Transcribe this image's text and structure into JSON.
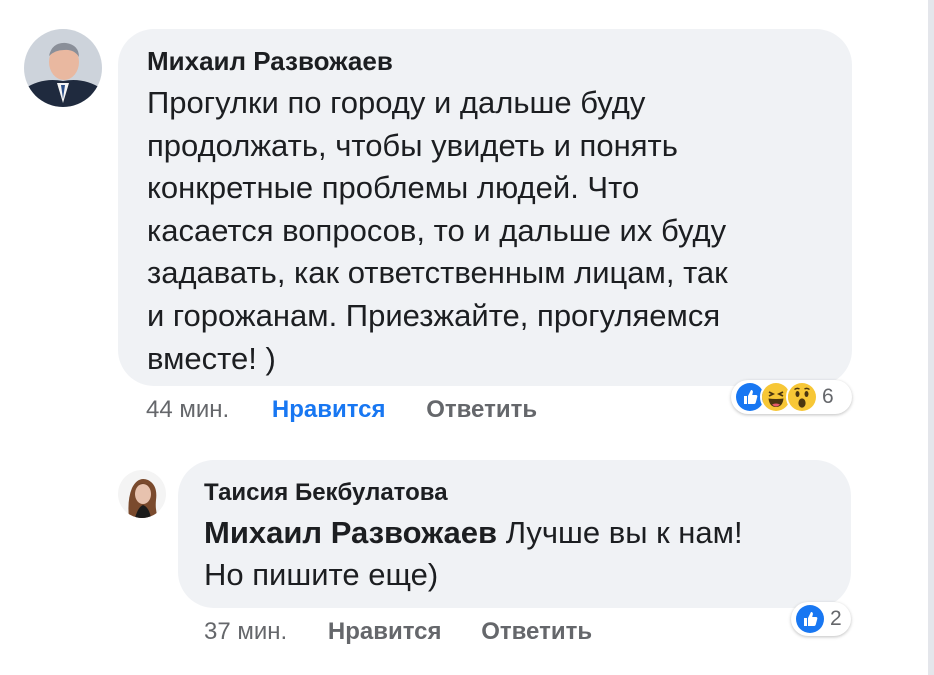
{
  "comments": [
    {
      "author": "Михаил Развожаев",
      "text": "Прогулки по городу и дальше буду\nпродолжать, чтобы увидеть и понять\nконкретные проблемы людей. Что\nкасается вопросов, то и дальше их буду\nзадавать, как ответственным лицам, так\nи горожанам. Приезжайте, прогуляемся\nвместе! )",
      "time": "44 мин.",
      "like_label": "Нравится",
      "reply_label": "Ответить",
      "reaction_icons": [
        "like-icon",
        "haha-icon",
        "wow-icon"
      ],
      "reaction_count": "6"
    },
    {
      "author": "Таисия Бекбулатова",
      "mention": "Михаил Развожаев",
      "text": " Лучше вы к нам!\nНо пишите еще)",
      "time": "37 мин.",
      "like_label": "Нравится",
      "reply_label": "Ответить",
      "reaction_icons": [
        "like-icon"
      ],
      "reaction_count": "2"
    }
  ],
  "colors": {
    "bubble": "#f0f2f5",
    "like_active": "#1877f2",
    "meta": "#65676b",
    "text": "#1c1e21"
  }
}
